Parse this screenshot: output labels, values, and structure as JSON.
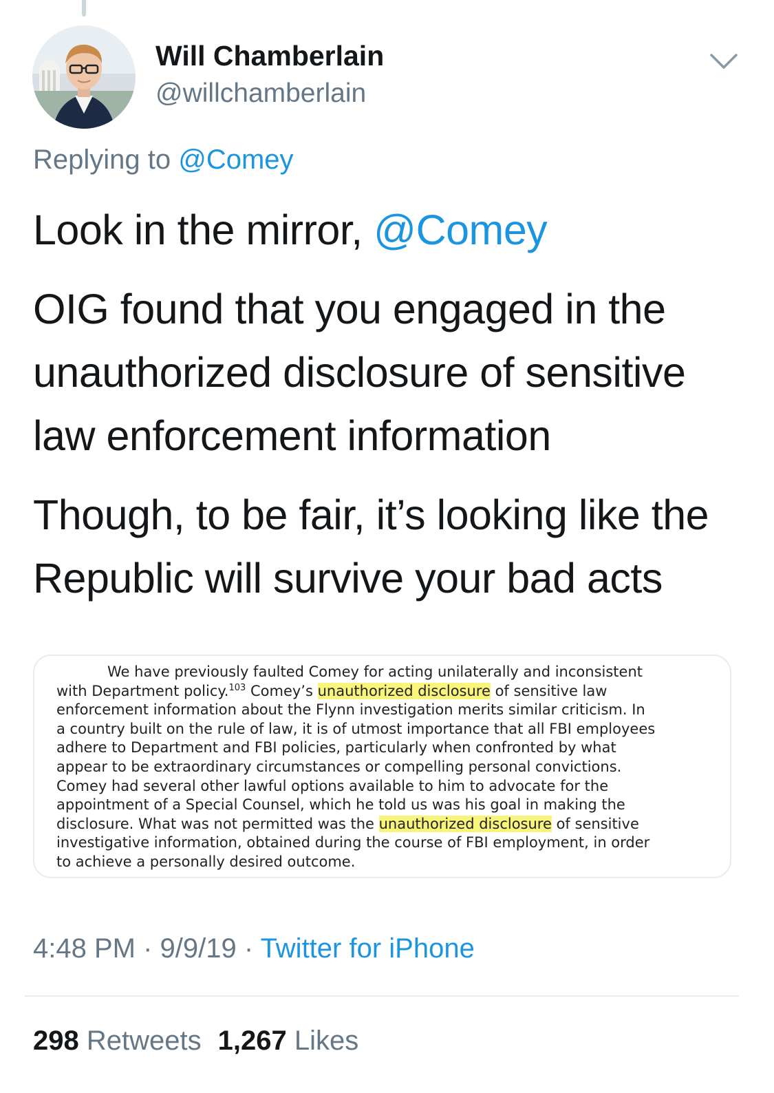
{
  "author": {
    "name": "Will Chamberlain",
    "handle": "@willchamberlain"
  },
  "replying": {
    "prefix": "Replying to ",
    "to": "@Comey"
  },
  "tweet": {
    "line1_text": "Look in the mirror, ",
    "line1_mention": "@Comey",
    "para2": "OIG found that you engaged in the unauthorized disclosure of sensitive law enforcement information",
    "para3": "Though, to be fair, it’s looking like the Republic will survive your bad acts"
  },
  "document": {
    "l1": "We have previously faulted Comey for acting unilaterally and inconsistent",
    "l2a": "with Department policy.",
    "l2_footnote": "103",
    "l2b": "  Comey’s ",
    "l2_highlight": "unauthorized disclosure",
    "l2c": " of sensitive law",
    "l3": "enforcement information about the Flynn investigation merits similar criticism.  In",
    "l4": "a country built on the rule of law, it is of utmost importance that all FBI employees",
    "l5": "adhere to Department and FBI policies, particularly when confronted by what",
    "l6": "appear to be extraordinary circumstances or compelling personal convictions.",
    "l7": "Comey had several other lawful options available to him to advocate for the",
    "l8": "appointment of a Special Counsel, which he told us was his goal in making the",
    "l9a": "disclosure.  What was not permitted was the ",
    "l9_highlight": "unauthorized disclosure",
    "l9b": " of sensitive",
    "l10": "investigative information, obtained during the course of FBI employment, in order",
    "l11": "to achieve a personally desired outcome."
  },
  "meta": {
    "time": "4:48 PM",
    "sep1": " · ",
    "date": "9/9/19",
    "sep2": " · ",
    "source": "Twitter for iPhone"
  },
  "stats": {
    "retweets_count": "298",
    "retweets_label": " Retweets",
    "likes_count": "1,267",
    "likes_label": " Likes"
  },
  "colors": {
    "link": "#1b95e0",
    "secondary_text": "#657786",
    "primary_text": "#14171a",
    "highlight": "#f9f57a",
    "border": "#e6ecf0"
  },
  "icons": {
    "menu": "chevron-down-icon"
  }
}
